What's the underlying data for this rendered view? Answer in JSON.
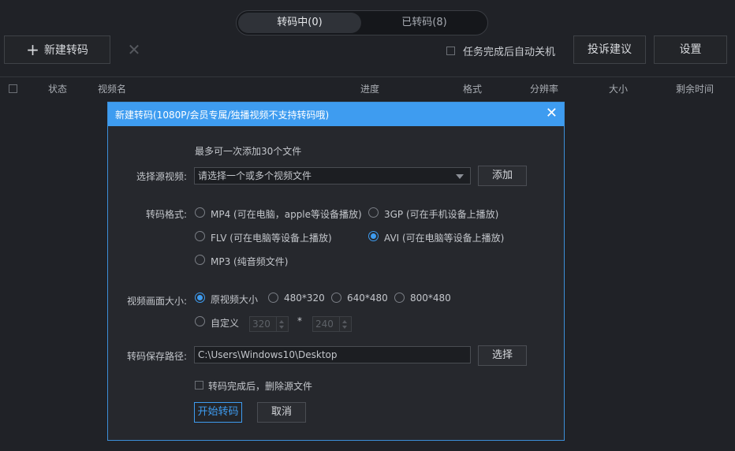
{
  "tabs": {
    "converting": "转码中(0)",
    "converted": "已转码(8)"
  },
  "toolbar": {
    "new_label": "新建转码",
    "auto_shutdown": "任务完成后自动关机",
    "complain": "投诉建议",
    "settings": "设置"
  },
  "table": {
    "columns": [
      "状态",
      "视频名",
      "进度",
      "格式",
      "分辨率",
      "大小",
      "剩余时间"
    ]
  },
  "dialog": {
    "title": "新建转码(1080P/会员专属/独播视频不支持转码哦)",
    "max_hint": "最多可一次添加30个文件",
    "source_label": "选择源视频:",
    "source_placeholder": "请选择一个或多个视频文件",
    "add_button": "添加",
    "format_label": "转码格式:",
    "formats": [
      {
        "label": "MP4 (可在电脑，apple等设备播放)",
        "selected": false
      },
      {
        "label": "3GP  (可在手机设备上播放)",
        "selected": false
      },
      {
        "label": "FLV  (可在电脑等设备上播放)",
        "selected": false
      },
      {
        "label": "AVI  (可在电脑等设备上播放)",
        "selected": true
      },
      {
        "label": "MP3 (纯音频文件)",
        "selected": false
      }
    ],
    "size_label": "视频画面大小:",
    "sizes": [
      {
        "label": "原视频大小",
        "selected": true
      },
      {
        "label": "480*320",
        "selected": false
      },
      {
        "label": "640*480",
        "selected": false
      },
      {
        "label": "800*480",
        "selected": false
      }
    ],
    "custom_label": "自定义",
    "custom_width": "320",
    "custom_times": "*",
    "custom_height": "240",
    "path_label": "转码保存路径:",
    "path_value": "C:\\Users\\Windows10\\Desktop",
    "choose_button": "选择",
    "delete_source": "转码完成后，删除源文件",
    "start_button": "开始转码",
    "cancel_button": "取消"
  },
  "colors": {
    "accent": "#3e9cf0",
    "background": "#202227",
    "dialog_bg": "#26282d"
  }
}
